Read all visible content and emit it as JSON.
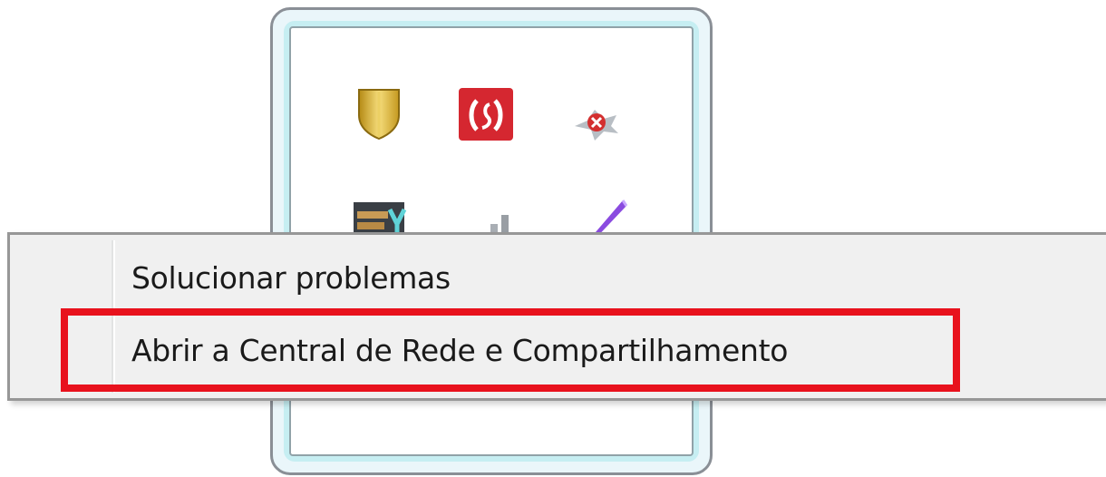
{
  "tray_popup": {
    "icons": [
      {
        "name": "security-shield-icon",
        "color": "#d8b53a"
      },
      {
        "name": "adobe-flash-icon",
        "color": "#d9232e"
      },
      {
        "name": "network-error-icon",
        "color": "#c0392b"
      },
      {
        "name": "display-driver-icon",
        "color": "#2a2f35"
      },
      {
        "name": "wireless-signal-icon",
        "color": "#9aa0a6"
      },
      {
        "name": "pen-tablet-icon",
        "color": "#7a3fd0"
      }
    ]
  },
  "context_menu": {
    "items": [
      {
        "label": "Solucionar problemas"
      },
      {
        "label": "Abrir a Central de Rede e Compartilhamento"
      }
    ]
  },
  "annotation": {
    "highlight_color": "#e8121d"
  }
}
